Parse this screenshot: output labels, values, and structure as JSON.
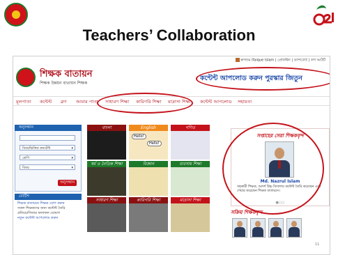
{
  "slide": {
    "title": "Teachers’ Collaboration",
    "page_number": "11"
  },
  "site": {
    "user_bar": "স্বাগতম Ifaique Islam | প্রোফাইল | ড্যাশবোর্ড | লগ আউট",
    "name": "শিক্ষক বাতায়ন",
    "tagline": "শিক্ষক উন্নয়ন বাতায়ন শিক্ষক",
    "promo": "কন্টেন্ট আপলোড করুন পুরস্কার জিতুন"
  },
  "nav": {
    "items": [
      "মূলপাতা",
      "কন্টেন্ট",
      "ব্লগ",
      "আমার পাতা",
      "সাধারণ শিক্ষা",
      "কারিগরি শিক্ষা",
      "মাদ্রাসা শিক্ষা",
      "কন্টেন্ট আপলোড",
      "সহায়তা"
    ]
  },
  "search": {
    "header": "অনুসন্ধান",
    "dropdowns": [
      "বিষয়ভিত্তিক কনটেন্ট",
      "শ্রেণি",
      "বিষয়"
    ],
    "button": "অনুসন্ধান"
  },
  "news": {
    "header": "নোটিশ",
    "items": [
      "শিক্ষক বাতায়নে শিক্ষক যোগ করুন",
      "সকল শিক্ষকদের জন্য কন্টেন্ট তৈরি",
      "প্রতিযোগিতার ফলাফল ঘোষণা",
      "নতুন কন্টেন্ট আপলোড করুন"
    ]
  },
  "tiles": [
    {
      "caption": "বাংলা",
      "cap_bg": "#8b1010",
      "cap_fg": "#ffffff",
      "art": "#1c1c1c"
    },
    {
      "caption": "English",
      "cap_bg": "#f08a1c",
      "cap_fg": "#ffffff",
      "art": "#f7e7c0"
    },
    {
      "caption": "গণিত",
      "cap_bg": "#c4121a",
      "cap_fg": "#ffffff",
      "art": "#e4e4f0"
    },
    {
      "caption": "ধর্ম ও নৈতিক শিক্ষা",
      "cap_bg": "#1e7a2a",
      "cap_fg": "#ffffff",
      "art": "#3c3a2a"
    },
    {
      "caption": "বিজ্ঞান",
      "cap_bg": "#1e7a2a",
      "cap_fg": "#ffffff",
      "art": "#efe0b0"
    },
    {
      "caption": "ব্যবসায় শিক্ষা",
      "cap_bg": "#1e7a2a",
      "cap_fg": "#ffffff",
      "art": "#d9e8d0"
    },
    {
      "caption": "সাধারণ শিক্ষা",
      "cap_bg": "#8b1010",
      "cap_fg": "#ffffff",
      "art": "#5a5a5a"
    },
    {
      "caption": "কারিগরি শিক্ষা",
      "cap_bg": "#8b1010",
      "cap_fg": "#ffffff",
      "art": "#7a7a7a"
    },
    {
      "caption": "মাদ্রাসা শিক্ষা",
      "cap_bg": "#c4121a",
      "cap_fg": "#ffffff",
      "art": "#d6c79a"
    }
  ],
  "tile_art_text": {
    "hello1": "Hello!",
    "hello2": "Hello!"
  },
  "featured": {
    "title": "সপ্তাহের সেরা শিক্ষকবৃন্দ",
    "teacher_name": "Md. Nazrul Islam",
    "description": "সহকারী শিক্ষক, আদর্শ উচ্চ বিদ্যালয় কন্টেন্ট তৈরি করেছেন এবং শেয়ার করেছেন শিক্ষক বাতায়নে।",
    "dots": "●○○"
  },
  "active": {
    "title": "সক্রিয় শিক্ষকবৃন্দ"
  },
  "colors": {
    "annotation": "#c4121a",
    "site_red": "#b0131f",
    "site_blue": "#1e62b0"
  }
}
